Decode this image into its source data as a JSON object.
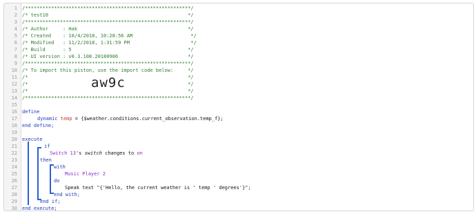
{
  "lines": [
    {
      "n": "1",
      "t": "/*********************************************************/"
    },
    {
      "n": "2",
      "t": "/* test10                                                */"
    },
    {
      "n": "3",
      "t": "/*********************************************************/"
    },
    {
      "n": "4",
      "t": "/* Author     : Hak                                      */"
    },
    {
      "n": "5",
      "t": "/* Created    : 10/4/2018, 10:28:56 AM                    */"
    },
    {
      "n": "6",
      "t": "/* Modified   : 11/2/2018, 1:31:59 PM                     */"
    },
    {
      "n": "7",
      "t": "/* Build      : 5                                        */"
    },
    {
      "n": "8",
      "t": "/* UI version : v0.3.108.20180906                        */"
    },
    {
      "n": "9",
      "t": "/*********************************************************/"
    },
    {
      "n": "10",
      "t": "/* To import this piston, use the import code below:     */"
    },
    {
      "n": "11",
      "t": "/*                                                       */"
    },
    {
      "n": "12",
      "t": "/*                                                       */"
    },
    {
      "n": "13",
      "t": "/*                                                       */"
    },
    {
      "n": "14",
      "t": "/*********************************************************/"
    },
    {
      "n": "15",
      "t": ""
    },
    {
      "n": "16",
      "t": "define"
    },
    {
      "n": "17",
      "t": "dynamic temp = {$weather.conditions.current_observation.temp_f};"
    },
    {
      "n": "18",
      "t": "end define;"
    },
    {
      "n": "19",
      "t": ""
    },
    {
      "n": "20",
      "t": "execute"
    },
    {
      "n": "21",
      "t": "if"
    },
    {
      "n": "22",
      "t": "Switch 13's switch changes to on"
    },
    {
      "n": "23",
      "t": "then"
    },
    {
      "n": "24",
      "t": "with"
    },
    {
      "n": "25",
      "t": "Music Player 2"
    },
    {
      "n": "26",
      "t": "do"
    },
    {
      "n": "27",
      "t": "Speak text \"{'Hello, the current weather is ' temp ' degrees'}\";"
    },
    {
      "n": "28",
      "t": "end with;"
    },
    {
      "n": "29",
      "t": "end if;"
    },
    {
      "n": "30",
      "t": "end execute;"
    }
  ],
  "import_code": "aw9c",
  "tokens": {
    "l17_dynamic": "dynamic",
    "l17_temp": "temp",
    "l17_rest": " = {$weather.conditions.current_observation.temp_f};",
    "l22_device": "Switch 13",
    "l22_poss": "'s ",
    "l22_attr": "switch",
    "l22_mid": " changes to ",
    "l22_val": "on",
    "l27_cmd": "Speak text ",
    "l27_str": "\"{'Hello, the current weather is ' temp ' degrees'}\";",
    "l25_device": "Music Player 2"
  },
  "colors": {
    "comment": "#2f7d2f",
    "keyword": "#1c38b8",
    "variable": "#cc3333",
    "device": "#8a2fc4",
    "indent_bar": "#2a5fd0"
  }
}
